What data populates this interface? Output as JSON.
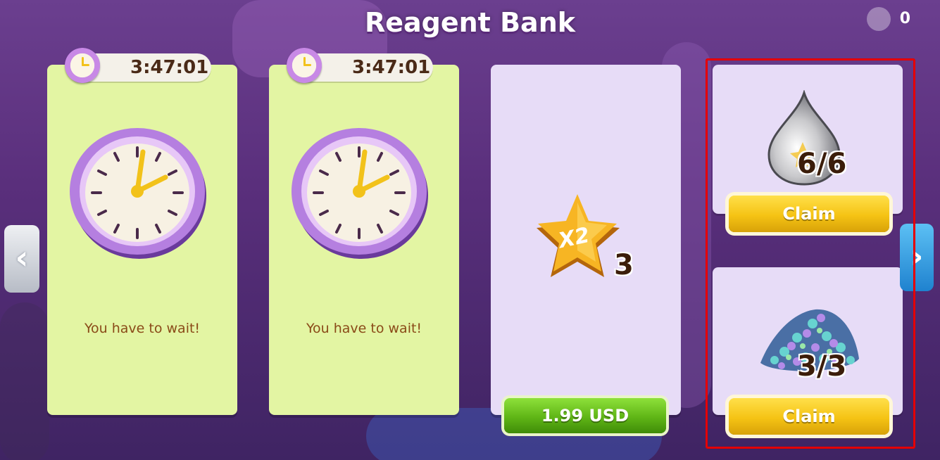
{
  "title": "Reagent Bank",
  "top_counter": "0",
  "cards": [
    {
      "timer": "3:47:01",
      "message": "You have to wait!"
    },
    {
      "timer": "3:47:01",
      "message": "You have to wait!"
    }
  ],
  "offer": {
    "badge": "X2",
    "quantity": "3",
    "price_label": "1.99 USD"
  },
  "rewards": [
    {
      "item": "drop",
      "count": "6/6",
      "button": "Claim"
    },
    {
      "item": "gems",
      "count": "3/3",
      "button": "Claim"
    }
  ],
  "nav": {
    "left": "‹",
    "right": "›"
  },
  "colors": {
    "card_green": "#e3f5a3",
    "card_lavender": "#e7dcf7",
    "highlight": "#e50000"
  }
}
